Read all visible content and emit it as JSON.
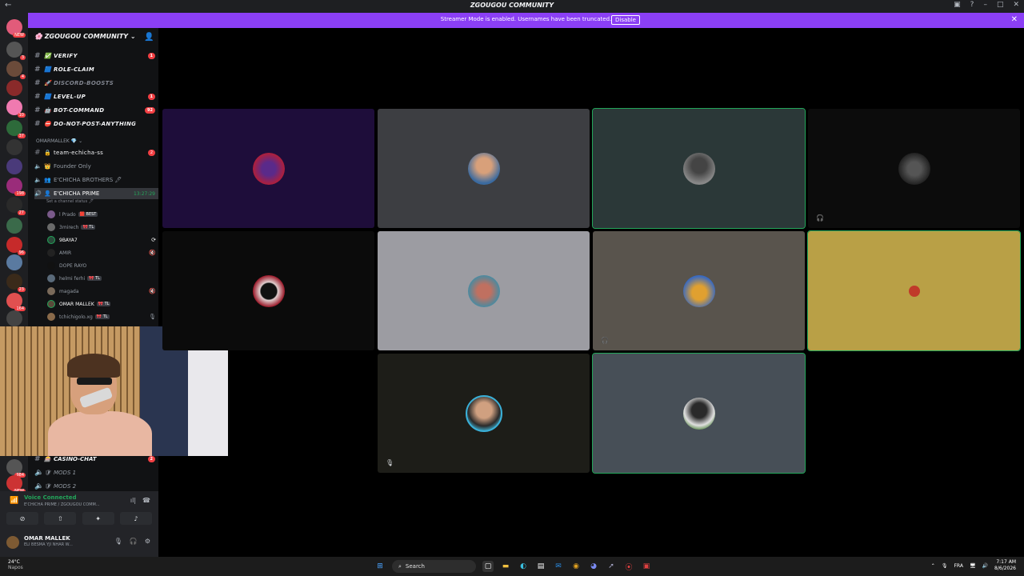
{
  "titlebar": {
    "title": "ZGOUGOU COMMUNITY"
  },
  "banner": {
    "text": "Streamer Mode is enabled. Usernames have been truncated.",
    "disable_label": "Disable"
  },
  "guild": {
    "name": "ZGOUGOU COMMUNITY"
  },
  "text_channels": [
    {
      "emoji": "✅",
      "label": "VERIFY",
      "badge": "1"
    },
    {
      "emoji": "🟦",
      "label": "ROLE-CLAIM",
      "badge": ""
    },
    {
      "emoji": "🚀",
      "label": "DISCORD-BOOSTS",
      "badge": "",
      "muted": true
    },
    {
      "emoji": "🟦",
      "label": "LEVEL-UP",
      "badge": "1"
    },
    {
      "emoji": "🤖",
      "label": "BOT-COMMAND",
      "badge": "92"
    },
    {
      "emoji": "⛔",
      "label": "DO-NOT-POST-ANYTHING",
      "badge": ""
    }
  ],
  "category": {
    "label": "OMARMALLEK 💎 ⌄"
  },
  "team_channel": {
    "label": "team-echicha-ss",
    "badge": "2"
  },
  "voice_channels": [
    {
      "label": "Founder Only"
    },
    {
      "label": "E'CHICHA BROTHERS 🖊"
    },
    {
      "label": "E'CHICHA PRIME",
      "time": "13:27:29",
      "active": true
    }
  ],
  "channel_status": "Set a channel status 🖊",
  "members": [
    {
      "name": "l Prado",
      "tag": "🟥 BEST"
    },
    {
      "name": "3mirech",
      "tag": "🎀 TL"
    },
    {
      "name": "9BAYA7",
      "tag": ""
    },
    {
      "name": "AMIR",
      "tag": ""
    },
    {
      "name": "DOPE RAYO",
      "tag": ""
    },
    {
      "name": "helmi ferhi",
      "tag": "🎀 TL"
    },
    {
      "name": "magada",
      "tag": ""
    },
    {
      "name": "OMAR MALLEK",
      "tag": "🎀 TL"
    },
    {
      "name": "tchichigolo.xg",
      "tag": "🎀 TL"
    }
  ],
  "lower_channels": [
    {
      "label": "CASINO-CHAT",
      "badge": "2",
      "voice": false
    },
    {
      "label": "MODS 1",
      "badge": "",
      "voice": true
    },
    {
      "label": "MODS 2",
      "badge": "",
      "voice": true
    }
  ],
  "voice_panel": {
    "status": "Voice Connected",
    "channel": "E'CHICHA PRIME / ZGOUGOU COMM...",
    "user": "OMAR MALLEK",
    "user_status": "ELI BESMA YJI NHAR W..."
  },
  "server_badges": [
    "NEW",
    "3",
    "4",
    "10",
    "37",
    "198",
    "27",
    "96",
    "23",
    "164",
    "984",
    "NEW"
  ],
  "taskbar": {
    "temp": "24°C",
    "weather": "Napos",
    "search": "Search",
    "lang": "FRA",
    "time": "7:17 AM",
    "date": "8/6/2026"
  },
  "colors": {
    "accent": "#8b3ff5",
    "speaking": "#23a55a",
    "badge": "#f23f43"
  }
}
